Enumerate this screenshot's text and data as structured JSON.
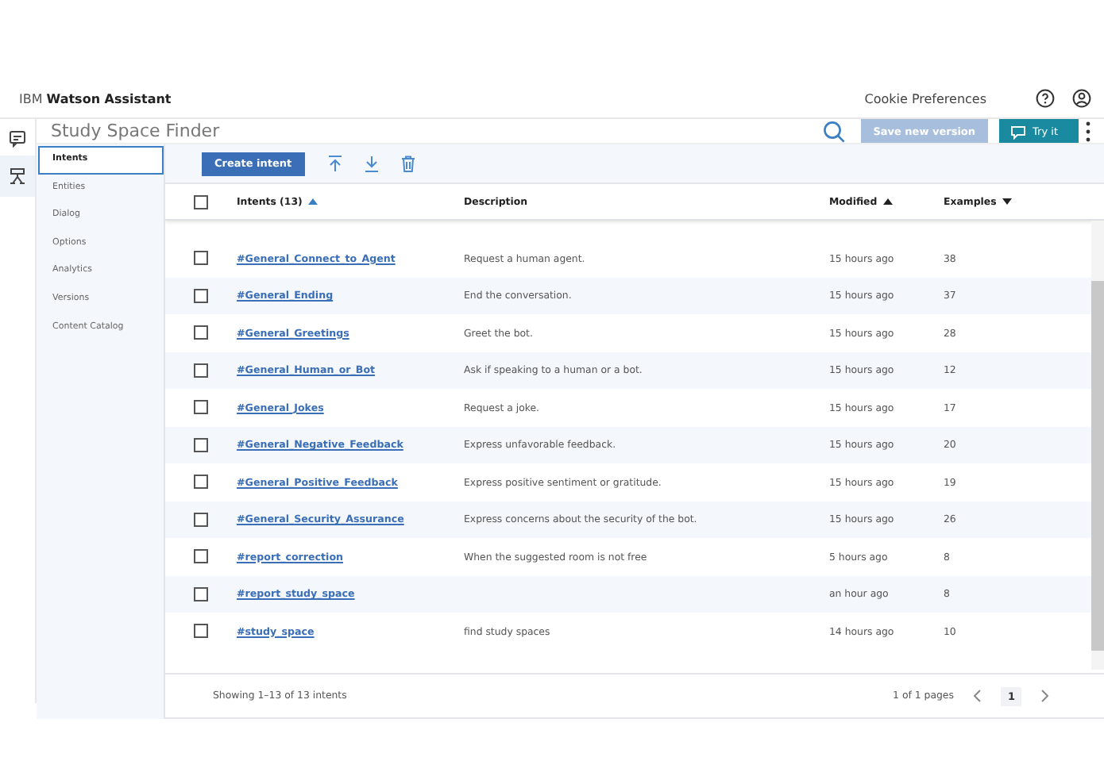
{
  "app": {
    "brand_light": "IBM",
    "brand_bold": "Watson Assistant",
    "links": [
      "Cookie Preferences"
    ]
  },
  "skill": {
    "title": "Study Space Finder",
    "save_button": {
      "label": "Save new version",
      "disabled": true
    },
    "try_button": "Try it"
  },
  "rail": [
    {
      "kind": "chat",
      "selected": false
    },
    {
      "kind": "skills",
      "selected": true
    }
  ],
  "nav": [
    {
      "label": "Intents",
      "selected": true
    },
    {
      "label": "Entities",
      "selected": false
    },
    {
      "label": "Dialog",
      "selected": false
    },
    {
      "label": "Options",
      "selected": false
    },
    {
      "label": "Analytics",
      "selected": false
    },
    {
      "label": "Versions",
      "selected": false
    },
    {
      "label": "Content Catalog",
      "selected": false
    }
  ],
  "toolbar": {
    "create_button": "Create intent"
  },
  "table": {
    "select_all_checked": false,
    "columns": [
      {
        "label": "Intents (13)",
        "sorted": true,
        "descending": false
      },
      {
        "label": "Description",
        "sorted": false
      },
      {
        "label": "Modified",
        "sorted": true,
        "descending": false
      },
      {
        "label": "Examples",
        "sorted": true,
        "descending": true
      }
    ],
    "rows": [
      {
        "intent": "#General_Connect_to_Agent",
        "description": "Request a human agent.",
        "modified": "15 hours ago",
        "examples": "38",
        "checked": false
      },
      {
        "intent": "#General_Ending",
        "description": "End the conversation.",
        "modified": "15 hours ago",
        "examples": "37",
        "checked": false
      },
      {
        "intent": "#General_Greetings",
        "description": "Greet the bot.",
        "modified": "15 hours ago",
        "examples": "28",
        "checked": false
      },
      {
        "intent": "#General_Human_or_Bot",
        "description": "Ask if speaking to a human or a bot.",
        "modified": "15 hours ago",
        "examples": "12",
        "checked": false
      },
      {
        "intent": "#General_Jokes",
        "description": "Request a joke.",
        "modified": "15 hours ago",
        "examples": "17",
        "checked": false
      },
      {
        "intent": "#General_Negative_Feedback",
        "description": "Express unfavorable feedback.",
        "modified": "15 hours ago",
        "examples": "20",
        "checked": false
      },
      {
        "intent": "#General_Positive_Feedback",
        "description": "Express positive sentiment or gratitude.",
        "modified": "15 hours ago",
        "examples": "19",
        "checked": false
      },
      {
        "intent": "#General_Security_Assurance",
        "description": "Express concerns about the security of the bot.",
        "modified": "15 hours ago",
        "examples": "26",
        "checked": false
      },
      {
        "intent": "#report_correction",
        "description": "When the suggested room is not free",
        "modified": "5 hours ago",
        "examples": "8",
        "checked": false
      },
      {
        "intent": "#report_study_space",
        "modified": "an hour ago",
        "examples": "8",
        "checked": false
      },
      {
        "intent": "#study_space",
        "description": "find study spaces",
        "modified": "14 hours ago",
        "examples": "10",
        "checked": false
      }
    ]
  },
  "footer": {
    "showing": "Showing 1–13 of 13 intents",
    "pages": "1 of 1 pages",
    "page": "1"
  }
}
